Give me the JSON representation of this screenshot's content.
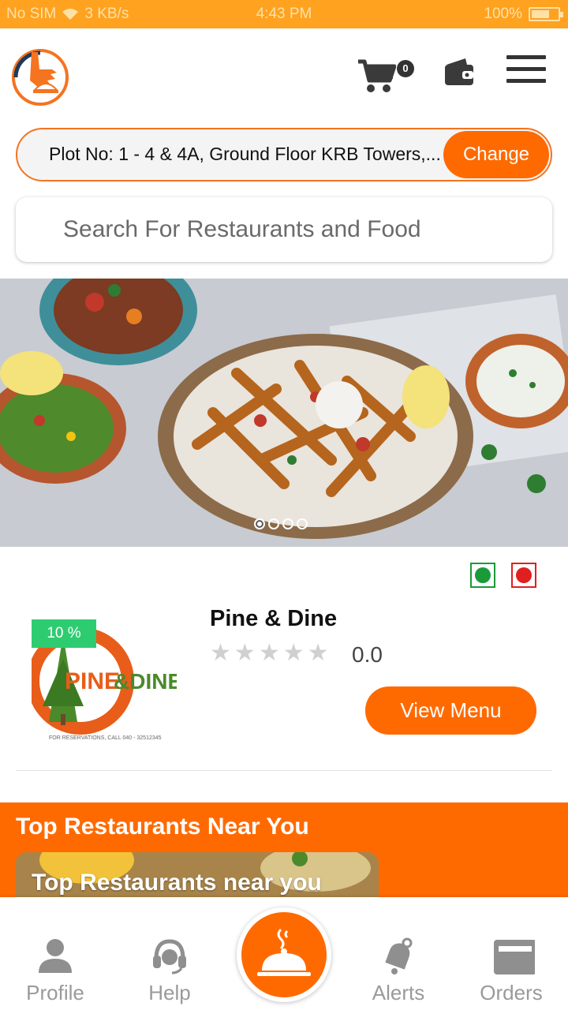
{
  "status_bar": {
    "carrier": "No SIM",
    "speed": "3 KB/s",
    "time": "4:43 PM",
    "battery": "100%"
  },
  "header": {
    "cart_count": "0",
    "icons": [
      "app-logo",
      "cart-icon",
      "wallet-icon",
      "hamburger-menu-icon"
    ]
  },
  "address": {
    "text": "Plot No: 1 - 4 & 4A, Ground Floor KRB Towers,...",
    "change_label": "Change"
  },
  "search": {
    "placeholder": "Search For Restaurants and Food"
  },
  "banner": {
    "slide_count": 4,
    "active_slide": 1
  },
  "filters": {
    "veg_color": "#1a9b3a",
    "nonveg_color": "#e02020"
  },
  "restaurant": {
    "name": "Pine & Dine",
    "discount": "10 %",
    "rating": "0.0",
    "stars": 0,
    "view_menu_label": "View Menu",
    "logo_text_main": "PINE",
    "logo_text_amp": "&DINE",
    "logo_reservation": "FOR RESERVATIONS, CALL 040 - 32512345"
  },
  "top_section": {
    "title": "Top Restaurants Near You",
    "card_title": "Top Restaurants near you"
  },
  "bottom_nav": {
    "items": [
      {
        "label": "Profile",
        "icon": "person-icon"
      },
      {
        "label": "Help",
        "icon": "headset-icon"
      },
      {
        "label": "",
        "icon": "cloche-icon"
      },
      {
        "label": "Alerts",
        "icon": "bell-icon"
      },
      {
        "label": "Orders",
        "icon": "orders-icon"
      }
    ]
  },
  "colors": {
    "accent": "#ff6a00",
    "status_bar": "#ffa21f",
    "discount_badge": "#2ecc71"
  }
}
